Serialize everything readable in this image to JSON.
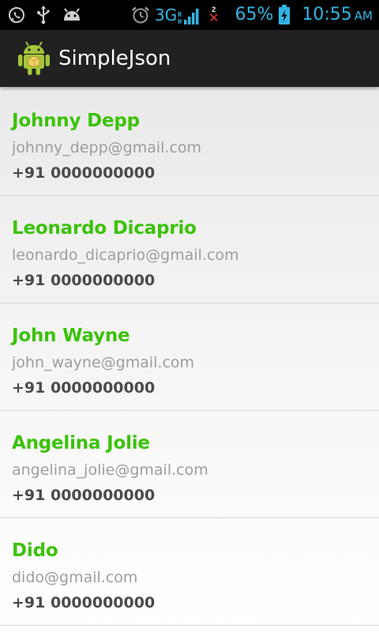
{
  "status_bar": {
    "network_label": "3G",
    "network_sub_top": "R",
    "network_sub_bottom": "H",
    "sim_number": "2",
    "sim_error": "✕",
    "battery_percent": "65%",
    "time": "10:55",
    "ampm": "AM",
    "accent_color": "#33b5e5"
  },
  "action_bar": {
    "title": "SimpleJson",
    "icon": "android-robot-icon"
  },
  "contacts": [
    {
      "name": "Johnny Depp",
      "email": "johnny_depp@gmail.com",
      "phone": "+91 0000000000"
    },
    {
      "name": "Leonardo Dicaprio",
      "email": "leonardo_dicaprio@gmail.com",
      "phone": "+91 0000000000"
    },
    {
      "name": "John Wayne",
      "email": "john_wayne@gmail.com",
      "phone": "+91 0000000000"
    },
    {
      "name": "Angelina Jolie",
      "email": "angelina_jolie@gmail.com",
      "phone": "+91 0000000000"
    },
    {
      "name": "Dido",
      "email": "dido@gmail.com",
      "phone": "+91 0000000000"
    }
  ],
  "colors": {
    "name": "#3cc20a",
    "email": "#9d9d9d",
    "phone": "#4a4a4a",
    "action_bar_bg": "#212121"
  }
}
